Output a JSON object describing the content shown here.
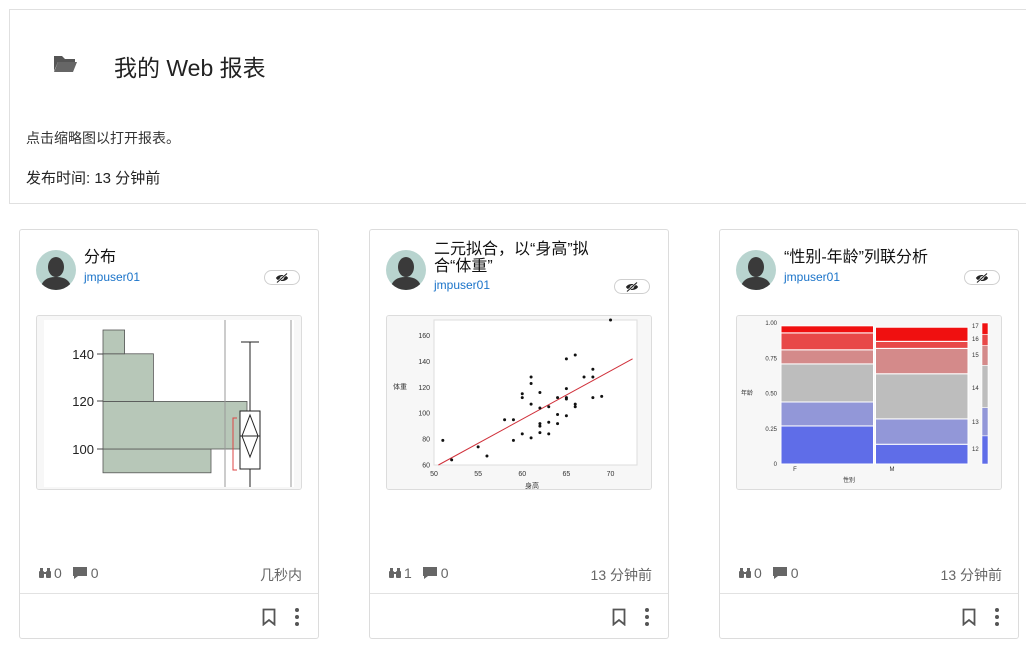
{
  "header": {
    "title": "我的 Web 报表",
    "subtitle": "点击缩略图以打开报表。",
    "published": "发布时间: 13 分钟前"
  },
  "cards": [
    {
      "title": "分布",
      "author": "jmpuser01",
      "views": "0",
      "comments": "0",
      "time": "几秒内",
      "thumb": {
        "type": "histogram-boxplot",
        "y_ticks": [
          "140",
          "120",
          "100"
        ]
      }
    },
    {
      "title": "二元拟合，以“身高”拟合“体重”",
      "author": "jmpuser01",
      "views": "1",
      "comments": "0",
      "time": "13 分钟前",
      "thumb": {
        "type": "scatter",
        "x_ticks": [
          "50",
          "55",
          "60",
          "65",
          "70"
        ],
        "y_ticks": [
          "60",
          "80",
          "100",
          "120",
          "140",
          "160"
        ],
        "xlabel": "身高",
        "ylabel": "体重"
      }
    },
    {
      "title": "“性别-年龄”列联分析",
      "author": "jmpuser01",
      "views": "0",
      "comments": "0",
      "time": "13 分钟前",
      "thumb": {
        "type": "mosaic",
        "y_ticks": [
          "1.00",
          "0.75",
          "0.50",
          "0.25",
          "0"
        ],
        "x_categories": [
          "F",
          "M"
        ],
        "xlabel": "性别",
        "ylabel": "年龄",
        "legend": [
          "17",
          "16",
          "15",
          "14",
          "13",
          "12"
        ]
      }
    }
  ],
  "chart_data": [
    {
      "type": "bar",
      "orientation": "horizontal-histogram",
      "bins": [
        {
          "range": [
            90,
            100
          ],
          "count": 3
        },
        {
          "range": [
            100,
            120
          ],
          "count": 4
        },
        {
          "range": [
            120,
            140
          ],
          "count": 1.4
        },
        {
          "range": [
            140,
            150
          ],
          "count": 0.6
        }
      ],
      "y_ticks": [
        100,
        120,
        140
      ]
    },
    {
      "type": "scatter",
      "xlabel": "身高",
      "ylabel": "体重",
      "xlim": [
        50,
        73
      ],
      "ylim": [
        60,
        172
      ],
      "x_ticks": [
        50,
        55,
        60,
        65,
        70
      ],
      "y_ticks": [
        60,
        80,
        100,
        120,
        140,
        160
      ],
      "points": [
        [
          51,
          79
        ],
        [
          52,
          64
        ],
        [
          55,
          74
        ],
        [
          56,
          67
        ],
        [
          58,
          95
        ],
        [
          59,
          79
        ],
        [
          59,
          95
        ],
        [
          60,
          84
        ],
        [
          60,
          112
        ],
        [
          60,
          115
        ],
        [
          61,
          81
        ],
        [
          61,
          107
        ],
        [
          61,
          123
        ],
        [
          61,
          128
        ],
        [
          62,
          85
        ],
        [
          62,
          90
        ],
        [
          62,
          92
        ],
        [
          62,
          104
        ],
        [
          62,
          116
        ],
        [
          63,
          84
        ],
        [
          63,
          93
        ],
        [
          63,
          105
        ],
        [
          64,
          92
        ],
        [
          64,
          99
        ],
        [
          64,
          112
        ],
        [
          65,
          98
        ],
        [
          65,
          111
        ],
        [
          65,
          112
        ],
        [
          65,
          119
        ],
        [
          65,
          142
        ],
        [
          66,
          105
        ],
        [
          66,
          107
        ],
        [
          66,
          145
        ],
        [
          67,
          128
        ],
        [
          68,
          112
        ],
        [
          68,
          128
        ],
        [
          68,
          134
        ],
        [
          69,
          113
        ],
        [
          70,
          172
        ]
      ],
      "fit_line": [
        [
          50.5,
          60
        ],
        [
          72.5,
          142
        ]
      ]
    },
    {
      "type": "mosaic",
      "xlabel": "性别",
      "ylabel": "年龄",
      "categories": [
        "F",
        "M"
      ],
      "column_share": [
        0.5,
        0.5
      ],
      "levels": [
        "12",
        "13",
        "14",
        "15",
        "16",
        "17"
      ],
      "series": [
        {
          "name": "F",
          "values": [
            0.27,
            0.17,
            0.27,
            0.1,
            0.12,
            0.05
          ]
        },
        {
          "name": "M",
          "values": [
            0.14,
            0.18,
            0.32,
            0.18,
            0.05,
            0.1
          ]
        }
      ],
      "colors": [
        "#5f6de8",
        "#9297d8",
        "#bdbdbd",
        "#d48a8a",
        "#e84848",
        "#f01010"
      ],
      "y_ticks": [
        0,
        0.25,
        0.5,
        0.75,
        1.0
      ]
    }
  ]
}
